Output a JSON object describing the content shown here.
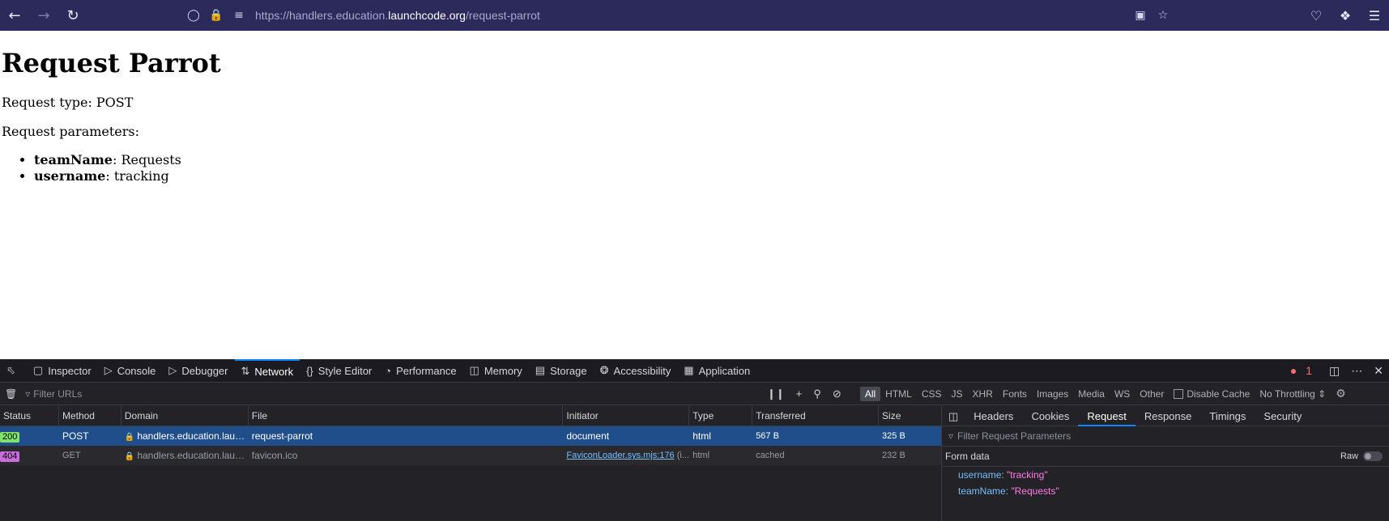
{
  "browser": {
    "url_prefix": "https://handlers.education.",
    "url_host": "launchcode.org",
    "url_path": "/request-parrot"
  },
  "page": {
    "title": "Request Parrot",
    "request_type_label": "Request type: POST",
    "params_label": "Request parameters:",
    "params": [
      {
        "key": "teamName",
        "value": ": Requests"
      },
      {
        "key": "username",
        "value": ": tracking"
      }
    ]
  },
  "devtools": {
    "tabs": [
      "Inspector",
      "Console",
      "Debugger",
      "Network",
      "Style Editor",
      "Performance",
      "Memory",
      "Storage",
      "Accessibility",
      "Application"
    ],
    "error_count": "1",
    "filter_placeholder": "Filter URLs",
    "type_filters": [
      "All",
      "HTML",
      "CSS",
      "JS",
      "XHR",
      "Fonts",
      "Images",
      "Media",
      "WS",
      "Other"
    ],
    "disable_cache": "Disable Cache",
    "throttling": "No Throttling ⇕",
    "columns": [
      "Status",
      "Method",
      "Domain",
      "File",
      "Initiator",
      "Type",
      "Transferred",
      "Size"
    ],
    "requests": [
      {
        "status": "200",
        "method": "POST",
        "domain": "handlers.education.laun...",
        "file": "request-parrot",
        "initiator": "document",
        "type": "html",
        "transferred": "567 B",
        "size": "325 B"
      },
      {
        "status": "404",
        "method": "GET",
        "domain": "handlers.education.laun...",
        "file": "favicon.ico",
        "initiator": "FaviconLoader.sys.mjs:176",
        "initiator_suffix": " (i...",
        "type": "html",
        "transferred": "cached",
        "size": "232 B"
      }
    ],
    "side_tabs": [
      "Headers",
      "Cookies",
      "Request",
      "Response",
      "Timings",
      "Security"
    ],
    "side_filter_placeholder": "Filter Request Parameters",
    "form_data_label": "Form data",
    "raw_label": "Raw",
    "form_params": [
      {
        "key": "username:",
        "value": "\"tracking\""
      },
      {
        "key": "teamName:",
        "value": "\"Requests\""
      }
    ]
  },
  "colors": {
    "status_200": "#7ee36a",
    "status_404": "#c86edb",
    "accent": "#0a84ff"
  }
}
